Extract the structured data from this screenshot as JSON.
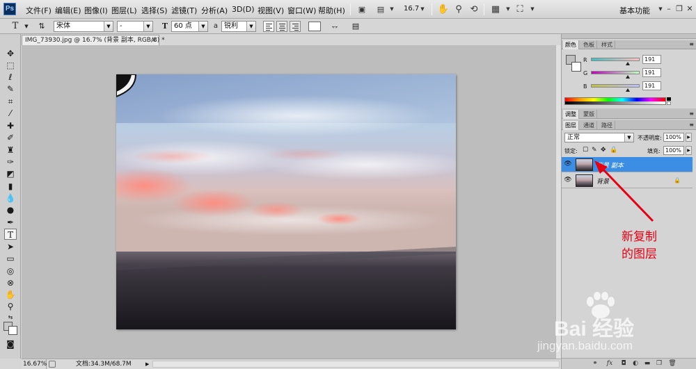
{
  "app": {
    "logo": "Ps"
  },
  "menu": [
    "文件(F)",
    "编辑(E)",
    "图像(I)",
    "图层(L)",
    "选择(S)",
    "滤镜(T)",
    "分析(A)",
    "3D(D)",
    "视图(V)",
    "窗口(W)",
    "帮助(H)"
  ],
  "menubar": {
    "zoom": "16.7",
    "workspace": "基本功能",
    "workspace_dropdown": "▼"
  },
  "options": {
    "tool_glyph": "T",
    "font_family": "宋体",
    "font_style": "-",
    "size_icon": "T",
    "font_size": "60 点",
    "aa_icon": "a",
    "antialias": "锐利"
  },
  "document": {
    "tab_title": "IMG_73930.jpg @ 16.7% (背景 副本, RGB/8) *",
    "close_glyph": "×"
  },
  "status": {
    "zoom": "16.67%",
    "doc_info": "文档:34.3M/68.7M"
  },
  "color_panel": {
    "tabs": [
      "颜色",
      "色板",
      "样式"
    ],
    "active_tab": 0,
    "channels": [
      {
        "label": "R",
        "value": "191",
        "gradient": "linear-gradient(to right,#40bfbf,#ffbfbf)"
      },
      {
        "label": "G",
        "value": "191",
        "gradient": "linear-gradient(to right,#bf00bf,#bfffbf)"
      },
      {
        "label": "B",
        "value": "191",
        "gradient": "linear-gradient(to right,#bfbf40,#bfbfff)"
      }
    ]
  },
  "adjust_panel": {
    "tabs": [
      "调整",
      "蒙版"
    ],
    "active_tab": 0
  },
  "layers_panel": {
    "tabs": [
      "图层",
      "通道",
      "路径"
    ],
    "active_tab": 0,
    "blend_mode": "正常",
    "opacity_label": "不透明度:",
    "opacity": "100%",
    "lock_label": "锁定:",
    "fill_label": "填充:",
    "fill": "100%",
    "layers": [
      {
        "name": "背景 副本",
        "selected": true,
        "locked": false
      },
      {
        "name": "背景",
        "selected": false,
        "locked": true
      }
    ]
  },
  "annotation": {
    "line1": "新复制",
    "line2": "的图层",
    "color": "#e60012"
  },
  "watermark": {
    "brand": "Bai 经验",
    "url": "jingyan.baidu.com"
  },
  "icons": {
    "eye": "visibility-eye-icon",
    "lock": "lock-icon",
    "hand": "hand-icon",
    "zoom": "zoom-icon",
    "rotate": "rotate-view-icon"
  }
}
